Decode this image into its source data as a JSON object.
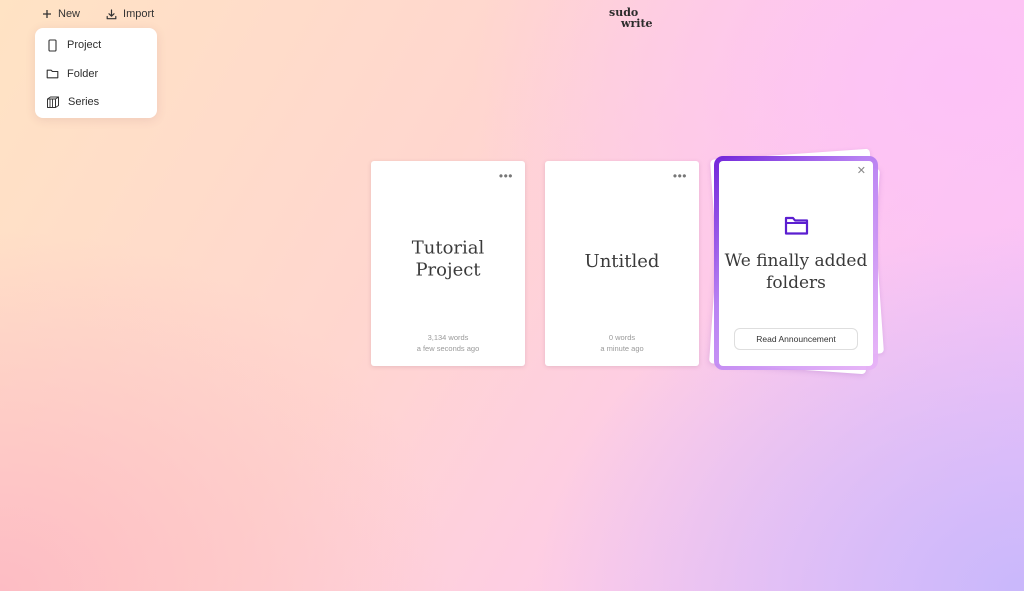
{
  "toolbar": {
    "new_label": "New",
    "import_label": "Import"
  },
  "logo": {
    "line1": "sudo",
    "line2": "write"
  },
  "new_menu": {
    "items": [
      {
        "label": "Project",
        "icon": "document-icon"
      },
      {
        "label": "Folder",
        "icon": "folder-icon"
      },
      {
        "label": "Series",
        "icon": "books-icon"
      }
    ]
  },
  "projects": [
    {
      "title": "Tutorial Project",
      "words": "3,134 words",
      "updated": "a few seconds ago"
    },
    {
      "title": "Untitled",
      "words": "0 words",
      "updated": "a minute ago"
    }
  ],
  "announcement": {
    "title": "We finally added folders",
    "button_label": "Read Announcement",
    "accent_color": "#6a1bd8"
  },
  "colors": {
    "accent": "#6a1bd8"
  }
}
